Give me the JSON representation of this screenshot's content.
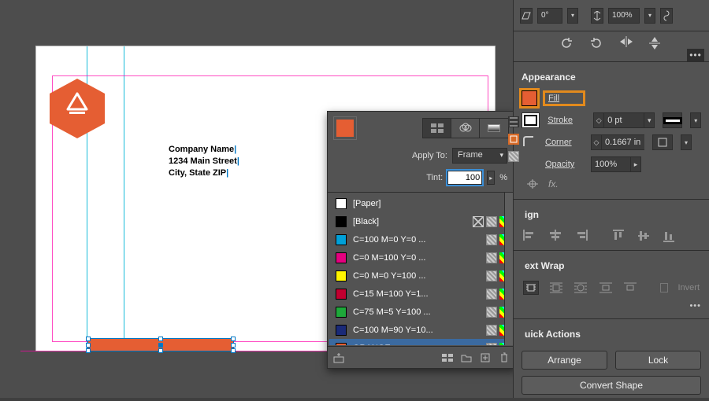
{
  "canvas": {
    "company_name": "Company Name",
    "company_addr1": "1234 Main Street",
    "company_addr2": "City, State ZIP"
  },
  "topbar": {
    "shear": "0°",
    "scale": "100%"
  },
  "swatches": {
    "apply_to_label": "Apply To:",
    "apply_to_value": "Frame",
    "tint_label": "Tint:",
    "tint_value": "100",
    "tint_unit": "%",
    "items": [
      {
        "name": "[Paper]",
        "color": "#ffffff",
        "icons": []
      },
      {
        "name": "[Black]",
        "color": "#000000",
        "icons": [
          "x",
          "hatch",
          "rainbow"
        ]
      },
      {
        "name": "C=100 M=0 Y=0 ...",
        "color": "#00a0d8",
        "icons": [
          "hatch",
          "rainbow"
        ]
      },
      {
        "name": "C=0 M=100 Y=0 ...",
        "color": "#e4007f",
        "icons": [
          "hatch",
          "rainbow"
        ]
      },
      {
        "name": "C=0 M=0 Y=100 ...",
        "color": "#fff500",
        "icons": [
          "hatch",
          "rainbow"
        ]
      },
      {
        "name": "C=15 M=100 Y=1...",
        "color": "#c20030",
        "icons": [
          "hatch",
          "rainbow"
        ]
      },
      {
        "name": "C=75 M=5 Y=100 ...",
        "color": "#1ea83a",
        "icons": [
          "hatch",
          "rainbow"
        ]
      },
      {
        "name": "C=100 M=90 Y=10...",
        "color": "#1a2a78",
        "icons": [
          "hatch",
          "rainbow"
        ]
      },
      {
        "name": "ORANGE",
        "color": "#e55e33",
        "icons": [
          "hatch",
          "rainbow"
        ],
        "selected": true
      }
    ]
  },
  "appearance": {
    "title": "Appearance",
    "fill_label": "Fill",
    "stroke_label": "Stroke",
    "stroke_val": "0 pt",
    "corner_label": "Corner",
    "corner_val": "0.1667 in",
    "opacity_label": "Opacity",
    "opacity_val": "100%",
    "fx": "fx."
  },
  "align": {
    "title": "ign"
  },
  "textwrap": {
    "title": "ext Wrap",
    "invert_label": "Invert"
  },
  "quick_actions": {
    "title": "uick Actions",
    "arrange": "Arrange",
    "lock": "Lock",
    "convert": "Convert Shape"
  }
}
